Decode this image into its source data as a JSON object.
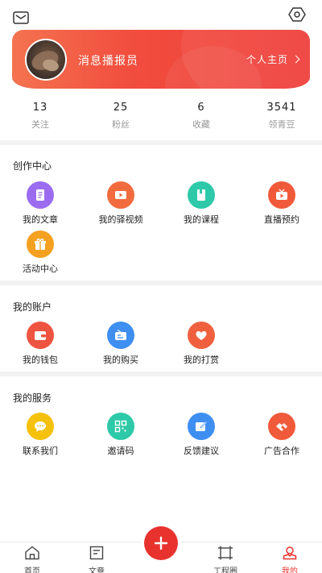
{
  "header": {
    "mail_icon": "mail-icon",
    "eye_icon": "eye-icon"
  },
  "profile": {
    "username": "消息播报员",
    "homepage_label": "个人主页",
    "banner_color": "#f14d3e"
  },
  "stats": [
    {
      "value": "13",
      "label": "关注"
    },
    {
      "value": "25",
      "label": "粉丝"
    },
    {
      "value": "6",
      "label": "收藏"
    },
    {
      "value": "3541",
      "label": "领青豆"
    }
  ],
  "creation": {
    "title": "创作中心",
    "items": [
      {
        "label": "我的文章",
        "icon": "article-icon",
        "color": "#9c6cf0"
      },
      {
        "label": "我的驿视频",
        "icon": "video-icon",
        "color": "#f26b3e"
      },
      {
        "label": "我的课程",
        "icon": "course-icon",
        "color": "#2ec9a8"
      },
      {
        "label": "直播预约",
        "icon": "live-icon",
        "color": "#f05a3a"
      },
      {
        "label": "活动中心",
        "icon": "gift-icon",
        "color": "#f4a020"
      }
    ]
  },
  "account": {
    "title": "我的账户",
    "items": [
      {
        "label": "我的钱包",
        "icon": "wallet-icon",
        "color": "#ef5440"
      },
      {
        "label": "我的购买",
        "icon": "purchase-icon",
        "color": "#3f8ef2"
      },
      {
        "label": "我的打赏",
        "icon": "heart-icon",
        "color": "#f0603e"
      }
    ]
  },
  "services": {
    "title": "我的服务",
    "items": [
      {
        "label": "联系我们",
        "icon": "chat-icon",
        "color": "#f5c10a"
      },
      {
        "label": "邀请码",
        "icon": "qrcode-icon",
        "color": "#2ec9a8"
      },
      {
        "label": "反馈建议",
        "icon": "feedback-icon",
        "color": "#3f8ef2"
      },
      {
        "label": "广告合作",
        "icon": "handshake-icon",
        "color": "#f05a3a"
      }
    ]
  },
  "tabbar": {
    "items": [
      {
        "label": "首页",
        "icon": "home-icon"
      },
      {
        "label": "文章",
        "icon": "article-tab-icon"
      },
      {
        "label": "工程圈",
        "icon": "frame-icon"
      },
      {
        "label": "我的",
        "icon": "profile-icon"
      }
    ],
    "active_color": "#e8322e",
    "fab_icon": "plus-icon"
  }
}
